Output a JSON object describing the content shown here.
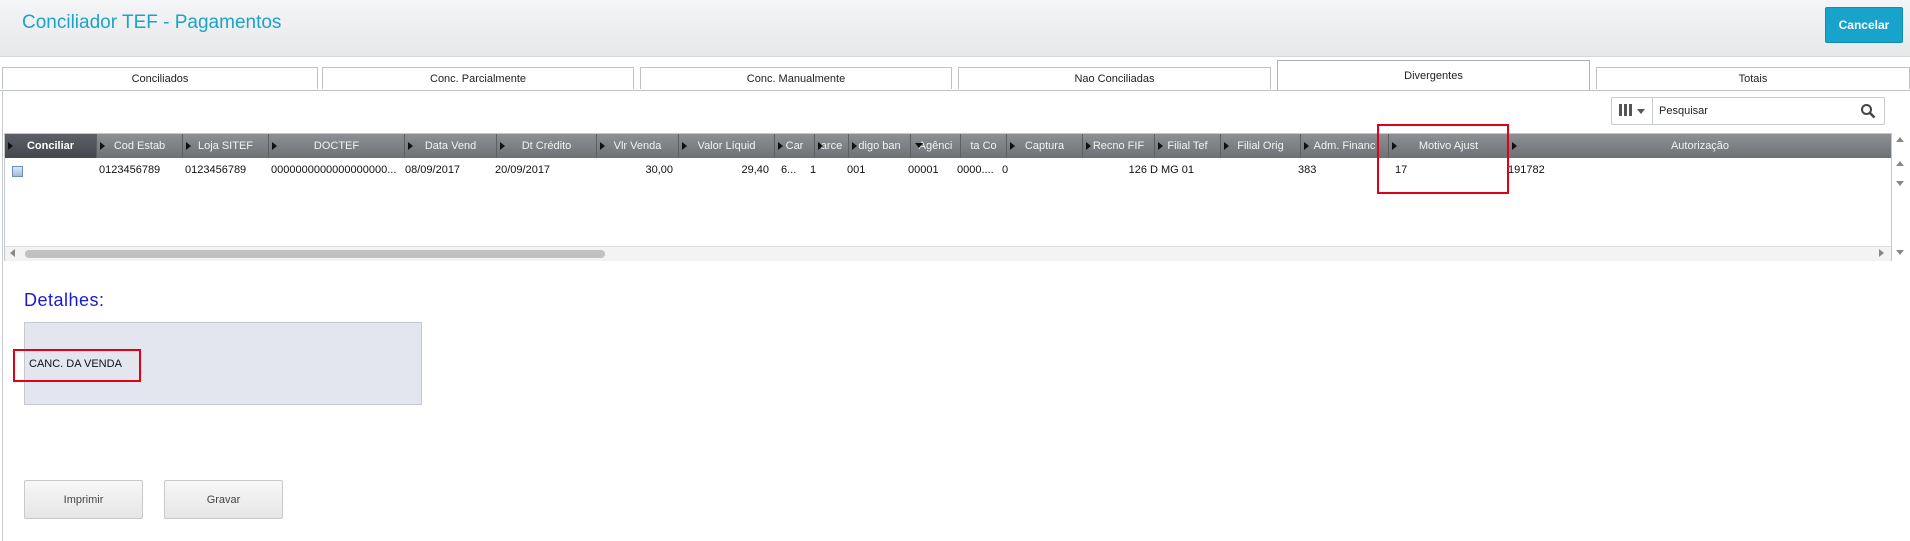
{
  "window": {
    "title": "Conciliador TEF - Pagamentos",
    "cancel_label": "Cancelar"
  },
  "tabs": [
    {
      "label": "Conciliados",
      "active": false
    },
    {
      "label": "Conc. Parcialmente",
      "active": false
    },
    {
      "label": "Conc. Manualmente",
      "active": false
    },
    {
      "label": "Nao Conciliadas",
      "active": false
    },
    {
      "label": "Divergentes",
      "active": true
    },
    {
      "label": "Totais",
      "active": false
    }
  ],
  "search": {
    "value": "Pesquisar",
    "icon": "search-icon"
  },
  "grid": {
    "headers": [
      "Conciliar",
      "Cod Estab",
      "Loja SITEF",
      "DOCTEF",
      "Data Vend",
      "Dt Crédito",
      "Vlr Venda",
      "Valor Líquid",
      "Car",
      "arce",
      "digo ban",
      "Agênci",
      "ta Co",
      "Captura",
      "Recno FIF",
      "Filial Tef",
      "Filial Orig",
      "Adm. Financ",
      "Motivo Ajust",
      "Autorização"
    ],
    "rows": [
      {
        "cod_estab": "0123456789",
        "loja_sitef": "0123456789",
        "doctef": "0000000000000000000...",
        "data_vend": "08/09/2017",
        "dt_credito": "20/09/2017",
        "vlr_venda": "30,00",
        "valor_liquido": "29,40",
        "cartao": "6...",
        "parcela": "1",
        "codigo_banco": "001",
        "agencia": "00001",
        "conta": "0000....",
        "captura": "0",
        "recno_fif": "126",
        "filial_tef": "D MG 01",
        "filial_orig": "",
        "adm_financ": "383",
        "motivo_ajust": "17",
        "autorizacao": "191782"
      }
    ]
  },
  "details": {
    "title": "Detalhes:",
    "text": "CANC. DA VENDA"
  },
  "buttons": {
    "print": "Imprimir",
    "save": "Gravar"
  },
  "colors": {
    "accent": "#17a3cc",
    "title": "#1ea2c6",
    "details_title": "#1a1ad6",
    "highlight": "#e0001a"
  }
}
